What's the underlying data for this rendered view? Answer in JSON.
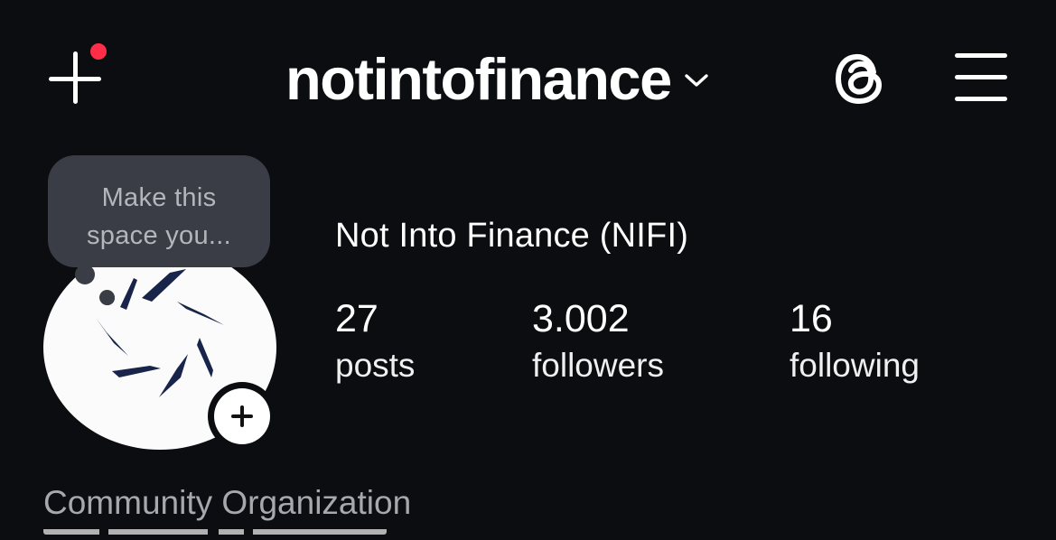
{
  "header": {
    "username": "notintofinance",
    "create_icon": "plus-icon",
    "threads_icon": "threads-icon",
    "menu_icon": "hamburger-menu-icon",
    "notification_dot_color": "#ff2d47"
  },
  "note": {
    "text_line1": "Make this",
    "text_line2": "space you..."
  },
  "profile": {
    "display_name": "Not Into Finance (NIFI)",
    "category": "Community Organization",
    "avatar_icon": "nifi-logo-icon",
    "add_story_icon": "plus-icon"
  },
  "stats": [
    {
      "value": "27",
      "label": "posts"
    },
    {
      "value": "3.002",
      "label": "followers"
    },
    {
      "value": "16",
      "label": "following"
    }
  ],
  "colors": {
    "background": "#0b0d11",
    "bubble": "#3a3d45",
    "secondary_text": "#a6a8ad",
    "logo_navy": "#18244a"
  }
}
